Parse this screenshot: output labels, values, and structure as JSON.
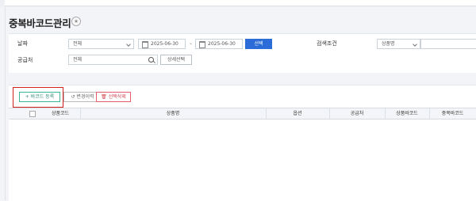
{
  "page": {
    "title": "중복바코드관리"
  },
  "filters": {
    "date_label": "날짜",
    "date_type_value": "전체",
    "date_from": "2025-06-30",
    "date_to": "2025-06-30",
    "select_button": "선택",
    "search_condition_label": "검색조건",
    "search_condition_value": "상품명",
    "supplier_label": "공급처",
    "supplier_value": "전체",
    "detail_select_button": "상세선택"
  },
  "toolbar": {
    "register_button": "+ 바코드 등록",
    "history_button": "변경이력",
    "delete_button": "선택삭제"
  },
  "table": {
    "columns": [
      "상품코드",
      "상품명",
      "옵션",
      "공급처",
      "상품바코드",
      "중복바코드"
    ]
  },
  "colors": {
    "primary": "#2b6cd8",
    "register_accent": "#3bb59a",
    "delete_accent": "#e35d6a",
    "highlight": "#d0201f"
  }
}
